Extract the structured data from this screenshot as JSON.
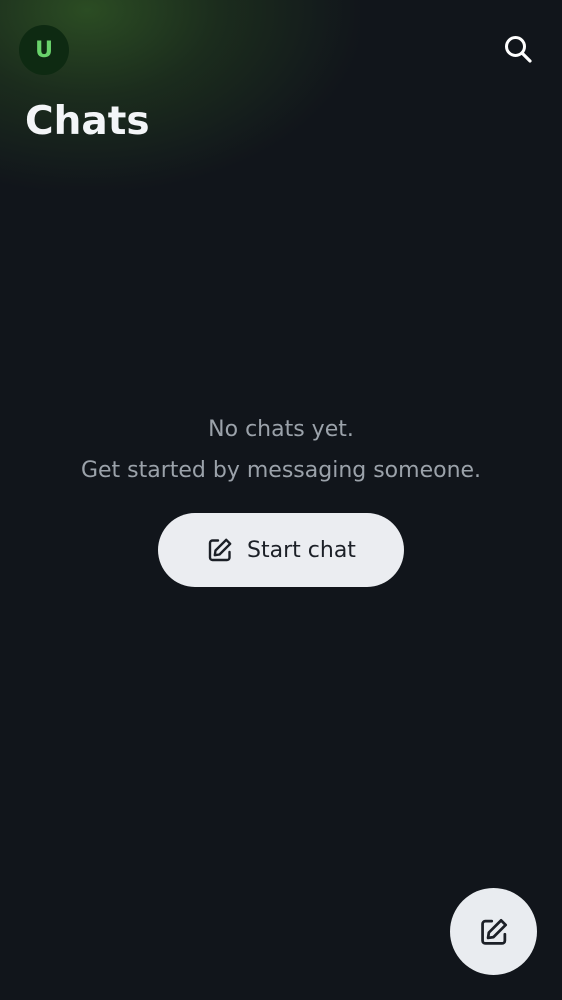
{
  "header": {
    "avatar_initial": "U",
    "title": "Chats",
    "search_icon": "search-icon"
  },
  "empty_state": {
    "line1": "No chats yet.",
    "line2": "Get started by messaging someone.",
    "button_label": "Start chat",
    "button_icon": "compose-icon"
  },
  "fab": {
    "icon": "compose-icon"
  },
  "colors": {
    "background": "#11151b",
    "accent_green": "#69d26b",
    "avatar_bg": "#0e2a12",
    "button_bg": "#ebedf1",
    "muted_text": "#9ba2aa",
    "title_text": "#f3f5f7"
  }
}
